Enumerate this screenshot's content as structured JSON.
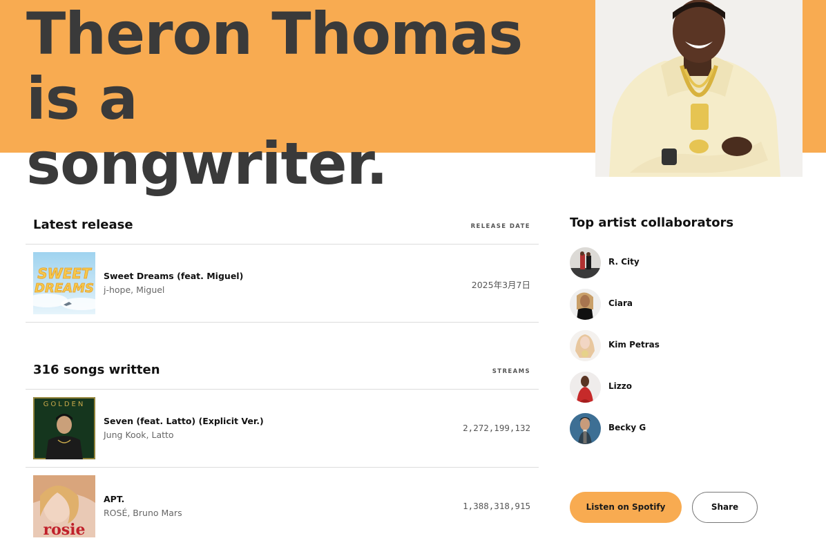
{
  "hero": {
    "title_line1": "Theron Thomas is a",
    "title_line2": "songwriter.",
    "background_color": "#f8ab51"
  },
  "latest_release": {
    "heading": "Latest release",
    "column_label": "RELEASE DATE",
    "item": {
      "song": "Sweet Dreams (feat. Miguel)",
      "artists": "j-hope, Miguel",
      "date": "2025年3月7日",
      "cover_text_1": "SWEET",
      "cover_text_2": "DREAMS"
    }
  },
  "songs": {
    "heading": "316 songs written",
    "column_label": "STREAMS",
    "items": [
      {
        "song": "Seven (feat. Latto) (Explicit Ver.)",
        "artists": "Jung Kook, Latto",
        "streams": "2,272,199,132",
        "cover_text": "GOLDEN"
      },
      {
        "song": "APT.",
        "artists": "ROSÉ, Bruno Mars",
        "streams": "1,388,318,915",
        "cover_text": "rosie"
      }
    ]
  },
  "collaborators": {
    "heading": "Top artist collaborators",
    "items": [
      {
        "name": "R. City"
      },
      {
        "name": "Ciara"
      },
      {
        "name": "Kim Petras"
      },
      {
        "name": "Lizzo"
      },
      {
        "name": "Becky G"
      }
    ]
  },
  "actions": {
    "listen_label": "Listen on Spotify",
    "share_label": "Share"
  }
}
